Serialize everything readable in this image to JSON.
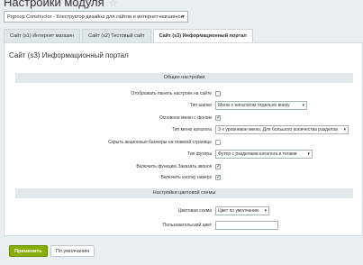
{
  "header": {
    "title": "Настройки модуля",
    "star_icon": "star-icon"
  },
  "module_select": {
    "value": "Prgroup Constructor - Конструктор дизайна для сайтов и интернет-магазинов"
  },
  "tabs": [
    {
      "label": "Сайт (s1) Интернет магазин"
    },
    {
      "label": "Сайт (s2) Тестовый сайт"
    },
    {
      "label": "Сайт (s3) Информационный портал"
    }
  ],
  "panel": {
    "title": "Сайт (s3) Информационный портал",
    "sections": {
      "general": "Общие настройки",
      "colors": "Настройки цветовой схемы"
    },
    "fields": {
      "show_panel": {
        "label": "Отображать панель настроек на сайте",
        "checked": false
      },
      "cap_type": {
        "label": "Тип шапки",
        "value": "Меню с каталогом отдельно внизу"
      },
      "main_menu_bg": {
        "label": "Основное меню с фоном",
        "checked": true
      },
      "menu_type": {
        "label": "Тип меню каталога",
        "value": "3-х уровневое меню. Для большого количества разделов"
      },
      "hide_banners": {
        "label": "Скрыть акционные баннеры на главной странице",
        "checked": false
      },
      "footer_type": {
        "label": "Тип футера",
        "value": "Футер с разделами каталога и тегами"
      },
      "order_call": {
        "label": "Включить функцию Заказать звонок",
        "checked": true
      },
      "up_button": {
        "label": "Включить кнопку наверх",
        "checked": true
      },
      "color_scheme": {
        "label": "Цветовая схема",
        "value": "Цвет по умолчанию"
      },
      "custom_color": {
        "label": "Пользовательский цвет",
        "value": ""
      }
    }
  },
  "buttons": {
    "apply": "Применить",
    "default": "По умолчанию"
  },
  "colors": {
    "accent": "#86ad00",
    "background": "#e9eef0",
    "section": "#e0e8ea"
  }
}
